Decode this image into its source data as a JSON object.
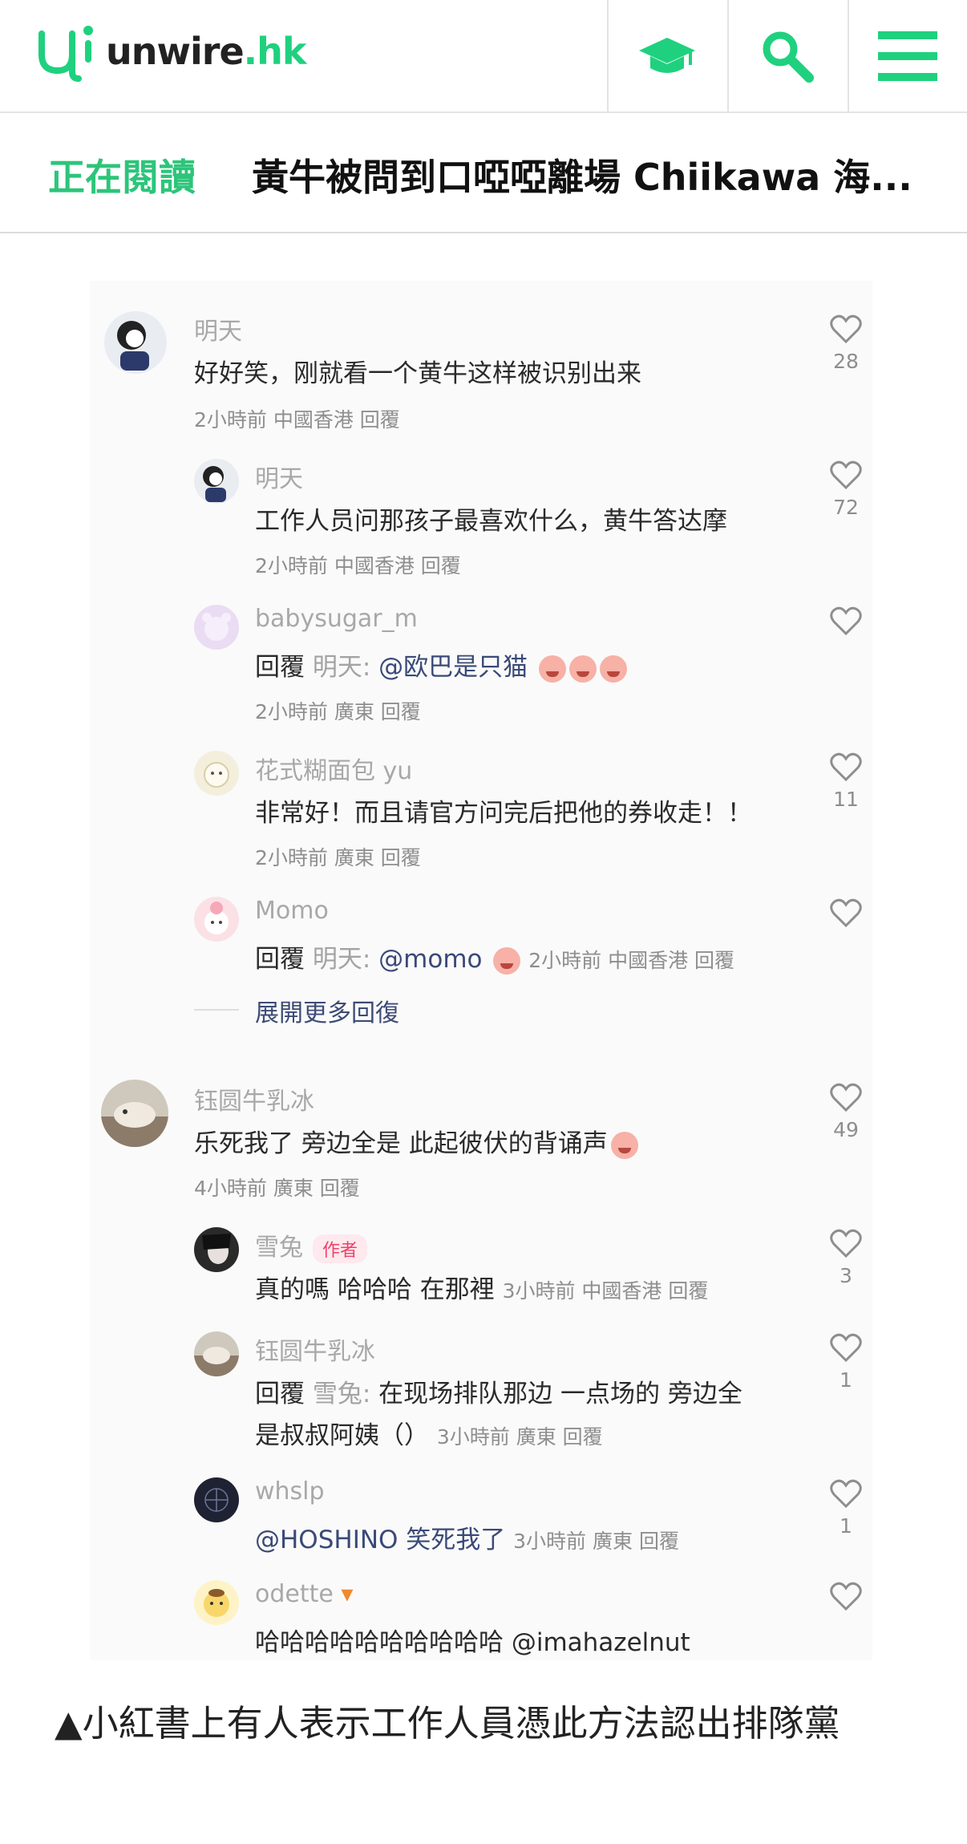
{
  "header": {
    "logo_text_main": "unwire",
    "logo_text_suffix": ".hk",
    "nav_icons": [
      "graduation-cap-icon",
      "search-icon",
      "menu-icon"
    ],
    "accent_color": "#1fd17e"
  },
  "reading": {
    "label": "正在閱讀",
    "title": "黃牛被問到口啞啞離場 Chiikawa 海..."
  },
  "comments": [
    {
      "name": "明天",
      "text": "好好笑，刚就看一个黄牛这样被识别出来",
      "meta": "2小時前 中國香港 回覆",
      "likes": "28"
    },
    {
      "name": "明天",
      "text": "工作人员问那孩子最喜欢什么，黄牛答达摩",
      "meta": "2小時前 中國香港 回覆",
      "likes": "72"
    },
    {
      "name": "babysugar_m",
      "text_prefix": "回覆",
      "text_reply_to": "明天:",
      "text_body": "@欧巴是只猫",
      "meta": "2小時前 廣東 回覆",
      "likes": ""
    },
    {
      "name": "花式糊面包 yu",
      "text": "非常好！而且请官方问完后把他的券收走！！",
      "meta": "2小時前 廣東 回覆",
      "likes": "11"
    },
    {
      "name": "Momo",
      "text_prefix": "回覆",
      "text_reply_to": "明天:",
      "text_body": "@momo",
      "meta": "2小時前 中國香港 回覆",
      "likes": ""
    },
    {
      "name": "钰圆牛乳冰",
      "text": "乐死我了 旁边全是 此起彼伏的背诵声",
      "meta": "4小時前 廣東 回覆",
      "likes": "49"
    },
    {
      "name": "雪兔",
      "badge": "作者",
      "text": "真的嗎 哈哈哈 在那裡",
      "meta": "3小時前 中國香港 回覆",
      "likes": "3"
    },
    {
      "name": "钰圆牛乳冰",
      "text_prefix": "回覆",
      "text_reply_to": "雪兔:",
      "text_body": "在现场排队那边 一点场的 旁边全",
      "text_line2": "是叔叔阿姨（）",
      "meta": "3小時前 廣東 回覆",
      "likes": "1"
    },
    {
      "name": "whslp",
      "text": "@HOSHINO 笑死我了",
      "meta": "3小時前 廣東 回覆",
      "likes": "1"
    },
    {
      "name": "odette",
      "text": "哈哈哈哈哈哈哈哈哈哈 @imahazelnut",
      "likes": ""
    }
  ],
  "expand_more": "展開更多回復",
  "caption": "▲小紅書上有人表示工作人員憑此方法認出排隊黨"
}
